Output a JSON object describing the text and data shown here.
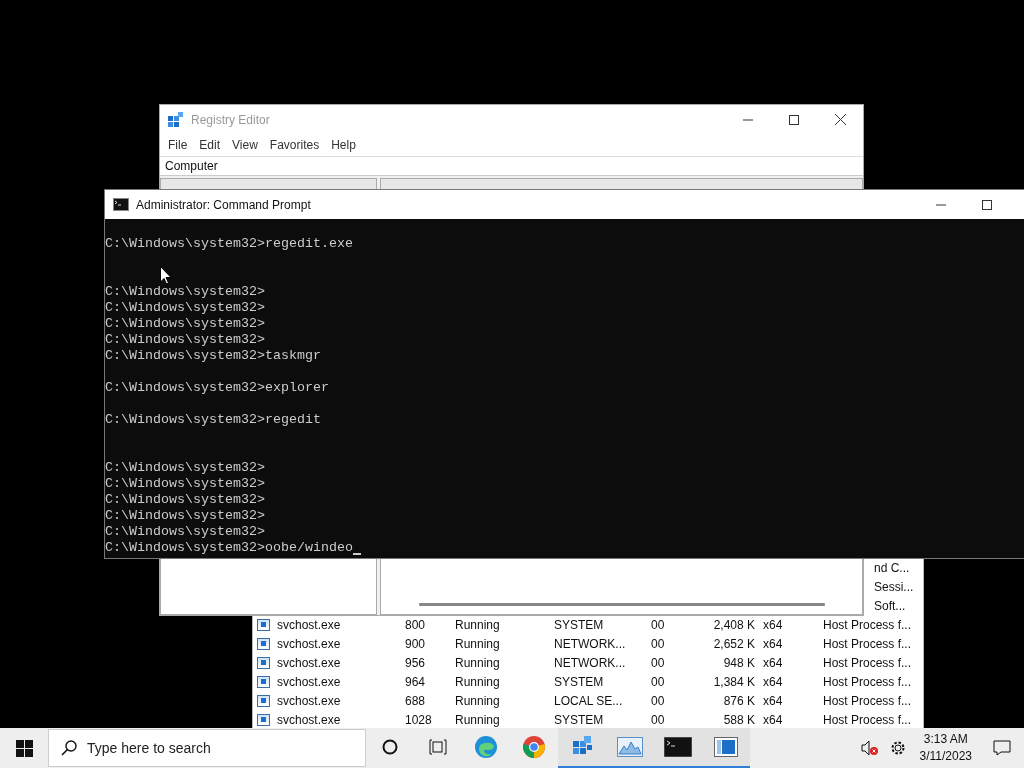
{
  "task_manager": {
    "rows": [
      {
        "description": "nd C..."
      },
      {
        "description": "Sessi..."
      },
      {
        "description": "Soft..."
      },
      {
        "name": "svchost.exe",
        "pid": "800",
        "status": "Running",
        "user": "SYSTEM",
        "cpu": "00",
        "memory": "2,408 K",
        "arch": "x64",
        "description": "Host Process f..."
      },
      {
        "name": "svchost.exe",
        "pid": "900",
        "status": "Running",
        "user": "NETWORK...",
        "cpu": "00",
        "memory": "2,652 K",
        "arch": "x64",
        "description": "Host Process f..."
      },
      {
        "name": "svchost.exe",
        "pid": "956",
        "status": "Running",
        "user": "NETWORK...",
        "cpu": "00",
        "memory": "948 K",
        "arch": "x64",
        "description": "Host Process f..."
      },
      {
        "name": "svchost.exe",
        "pid": "964",
        "status": "Running",
        "user": "SYSTEM",
        "cpu": "00",
        "memory": "1,384 K",
        "arch": "x64",
        "description": "Host Process f..."
      },
      {
        "name": "svchost.exe",
        "pid": "688",
        "status": "Running",
        "user": "LOCAL SE...",
        "cpu": "00",
        "memory": "876 K",
        "arch": "x64",
        "description": "Host Process f..."
      },
      {
        "name": "svchost.exe",
        "pid": "1028",
        "status": "Running",
        "user": "SYSTEM",
        "cpu": "00",
        "memory": "588 K",
        "arch": "x64",
        "description": "Host Process f..."
      }
    ]
  },
  "registry_editor": {
    "title": "Registry Editor",
    "menu": [
      "File",
      "Edit",
      "View",
      "Favorites",
      "Help"
    ],
    "address": "Computer"
  },
  "command_prompt": {
    "title": "Administrator:  Command Prompt",
    "cursor": true,
    "lines": [
      {
        "kind": "text",
        "text": "C:\\Windows\\system32>regedit.exe"
      },
      {
        "kind": "blank"
      },
      {
        "kind": "blank"
      },
      {
        "kind": "text",
        "text": "C:\\Windows\\system32>"
      },
      {
        "kind": "text",
        "text": "C:\\Windows\\system32>"
      },
      {
        "kind": "text",
        "text": "C:\\Windows\\system32>"
      },
      {
        "kind": "text",
        "text": "C:\\Windows\\system32>"
      },
      {
        "kind": "text",
        "text": "C:\\Windows\\system32>taskmgr"
      },
      {
        "kind": "blank"
      },
      {
        "kind": "text",
        "text": "C:\\Windows\\system32>explorer"
      },
      {
        "kind": "blank"
      },
      {
        "kind": "text",
        "text": "C:\\Windows\\system32>regedit"
      },
      {
        "kind": "blank"
      },
      {
        "kind": "blank"
      },
      {
        "kind": "text",
        "text": "C:\\Windows\\system32>"
      },
      {
        "kind": "text",
        "text": "C:\\Windows\\system32>"
      },
      {
        "kind": "text",
        "text": "C:\\Windows\\system32>"
      },
      {
        "kind": "text",
        "text": "C:\\Windows\\system32>"
      },
      {
        "kind": "text",
        "text": "C:\\Windows\\system32>"
      },
      {
        "kind": "text",
        "text": "C:\\Windows\\system32>oobe/windeo"
      }
    ]
  },
  "taskbar": {
    "search": {
      "placeholder": "Type here to search"
    },
    "apps": [
      {
        "kind": "edge",
        "running": false
      },
      {
        "kind": "chrome",
        "running": false
      },
      {
        "kind": "registry",
        "running": true
      },
      {
        "kind": "monitor",
        "running": true
      },
      {
        "kind": "console",
        "running": true
      },
      {
        "kind": "window",
        "running": true
      }
    ],
    "time": "3:13 AM",
    "date": "3/11/2023"
  }
}
